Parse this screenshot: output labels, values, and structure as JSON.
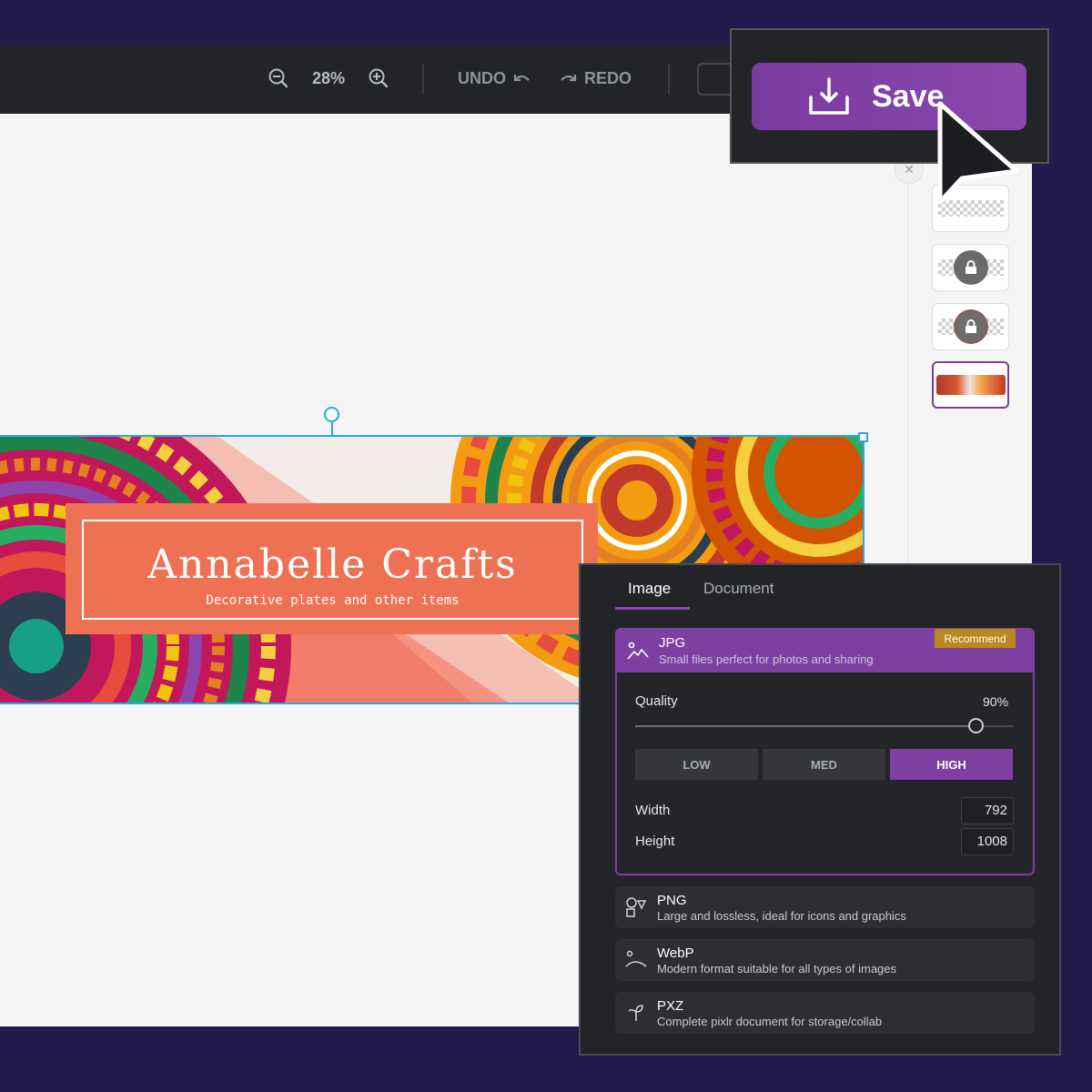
{
  "toolbar": {
    "zoom_level": "28%",
    "undo_label": "UNDO",
    "redo_label": "REDO"
  },
  "save": {
    "label": "Save"
  },
  "banner": {
    "title": "Annabelle Crafts",
    "subtitle": "Decorative plates and other items"
  },
  "export": {
    "tabs": [
      {
        "label": "Image",
        "active": true
      },
      {
        "label": "Document",
        "active": false
      }
    ],
    "formats": [
      {
        "name": "JPG",
        "description": "Small files perfect for photos and sharing",
        "badge": "Recommend",
        "icon": "landscape-icon",
        "selected": true
      },
      {
        "name": "PNG",
        "description": "Large and lossless, ideal for icons and graphics",
        "icon": "shapes-icon",
        "selected": false
      },
      {
        "name": "WebP",
        "description": "Modern format suitable for all types of images",
        "icon": "landscape-icon",
        "selected": false
      },
      {
        "name": "PXZ",
        "description": "Complete pixlr document for storage/collab",
        "icon": "pen-nib-icon",
        "selected": false
      }
    ],
    "quality": {
      "label": "Quality",
      "value": "90%",
      "fraction": 0.9
    },
    "quality_presets": [
      {
        "label": "LOW",
        "active": false
      },
      {
        "label": "MED",
        "active": false
      },
      {
        "label": "HIGH",
        "active": true
      }
    ],
    "width": {
      "label": "Width",
      "value": "792"
    },
    "height": {
      "label": "Height",
      "value": "1008"
    }
  },
  "colors": {
    "accent": "#7e3fa2",
    "background": "#221b4b",
    "panel": "#232427",
    "badge": "#b88a1e",
    "selection": "#2aa7df",
    "banner_plate": "#ef7153"
  }
}
